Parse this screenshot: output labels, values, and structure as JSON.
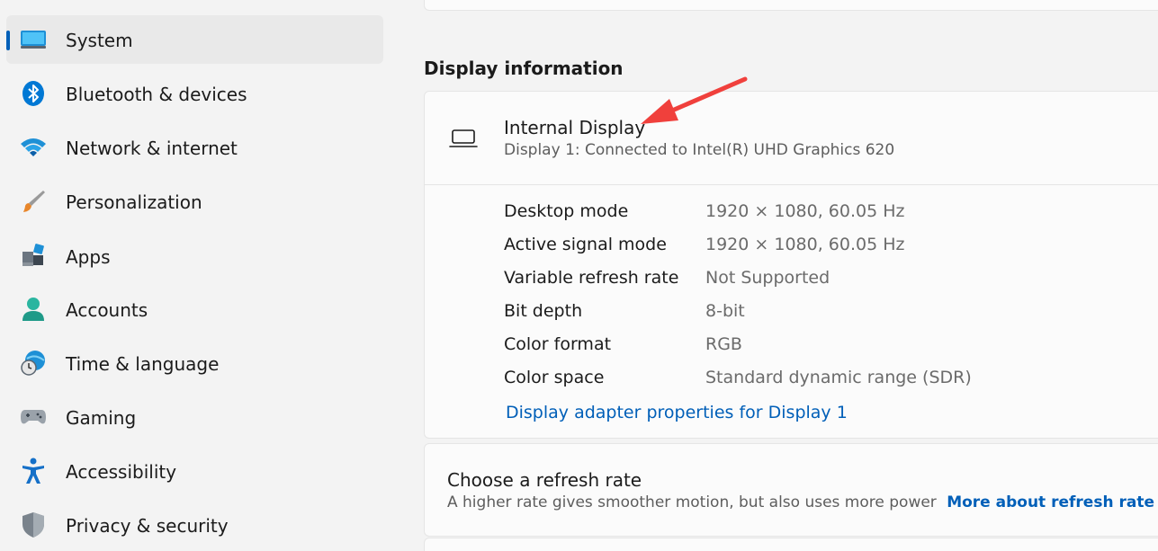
{
  "sidebar": {
    "items": [
      {
        "label": "System",
        "icon": "system-icon",
        "selected": true
      },
      {
        "label": "Bluetooth & devices",
        "icon": "bluetooth-icon"
      },
      {
        "label": "Network & internet",
        "icon": "wifi-icon"
      },
      {
        "label": "Personalization",
        "icon": "brush-icon"
      },
      {
        "label": "Apps",
        "icon": "apps-icon"
      },
      {
        "label": "Accounts",
        "icon": "account-icon"
      },
      {
        "label": "Time & language",
        "icon": "globe-clock-icon"
      },
      {
        "label": "Gaming",
        "icon": "gamepad-icon"
      },
      {
        "label": "Accessibility",
        "icon": "accessibility-icon"
      },
      {
        "label": "Privacy & security",
        "icon": "shield-icon"
      }
    ]
  },
  "main": {
    "section_title": "Display information",
    "display": {
      "title": "Internal Display",
      "subtitle": "Display 1: Connected to Intel(R) UHD Graphics 620",
      "icon": "laptop-icon"
    },
    "info": [
      {
        "label": "Desktop mode",
        "value": "1920 × 1080, 60.05 Hz"
      },
      {
        "label": "Active signal mode",
        "value": "1920 × 1080, 60.05 Hz"
      },
      {
        "label": "Variable refresh rate",
        "value": "Not Supported"
      },
      {
        "label": "Bit depth",
        "value": "8-bit"
      },
      {
        "label": "Color format",
        "value": "RGB"
      },
      {
        "label": "Color space",
        "value": "Standard dynamic range (SDR)"
      }
    ],
    "adapter_link": "Display adapter properties for Display 1",
    "refresh": {
      "title": "Choose a refresh rate",
      "description": "A higher rate gives smoother motion, but also uses more power",
      "link": "More about refresh rate"
    }
  },
  "colors": {
    "accent": "#005fb8",
    "annotation_arrow": "#f0403c"
  }
}
